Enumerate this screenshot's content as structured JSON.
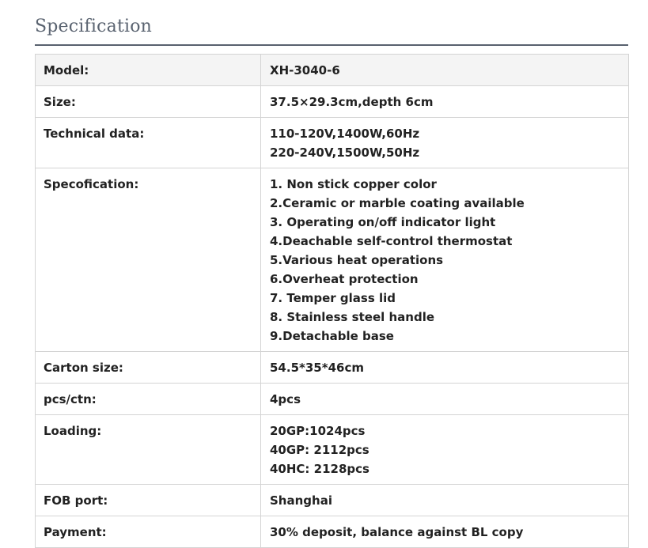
{
  "page": {
    "heading": "Specification"
  },
  "rows": {
    "model": {
      "label": "Model:",
      "value": "XH-3040-6"
    },
    "size": {
      "label": "Size:",
      "value": "37.5×29.3cm,depth 6cm"
    },
    "technical": {
      "label": "Technical data:",
      "lines": [
        "110-120V,1400W,60Hz",
        "220-240V,1500W,50Hz"
      ]
    },
    "specofication": {
      "label": "Specofication:",
      "lines": [
        "1. Non stick copper color",
        "2.Ceramic or marble coating available",
        "3. Operating on/off indicator light",
        "4.Deachable self-control thermostat",
        "5.Various heat operations",
        "6.Overheat protection",
        "7. Temper glass lid",
        "8. Stainless steel handle",
        "9.Detachable base"
      ]
    },
    "carton": {
      "label": "Carton size:",
      "value": "54.5*35*46cm"
    },
    "pcs": {
      "label": "pcs/ctn:",
      "value": "4pcs"
    },
    "loading": {
      "label": "Loading:",
      "lines": [
        "20GP:1024pcs",
        "40GP: 2112pcs",
        "40HC: 2128pcs"
      ]
    },
    "fob": {
      "label": "FOB port:",
      "value": "Shanghai"
    },
    "payment": {
      "label": "Payment:",
      "value": "30% deposit, balance against BL copy"
    }
  },
  "colors": {
    "heading_text": "#5b6471",
    "heading_rule": "#58616e",
    "border": "#d4d4d4",
    "first_row_bg": "#f4f4f4",
    "body_text": "#222222"
  }
}
